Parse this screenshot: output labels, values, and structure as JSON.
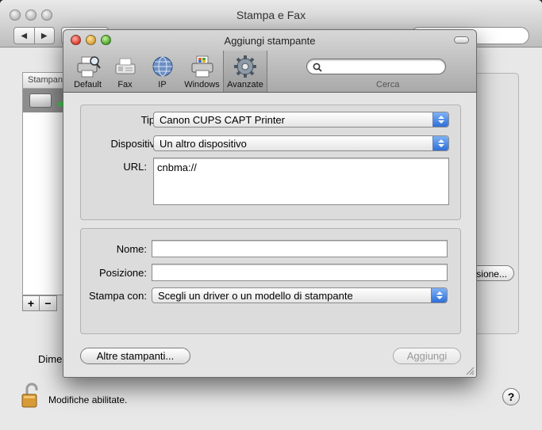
{
  "background_window": {
    "title": "Stampa e Fax",
    "printer_list_header": "Stampan",
    "options_button_partial": "sione...",
    "default_label_partial": "Dime",
    "lock_label": "Modifiche abilitate.",
    "help_glyph": "?",
    "add_glyph": "+",
    "remove_glyph": "−",
    "back_glyph": "◀",
    "forward_glyph": "▶"
  },
  "dialog": {
    "title": "Aggiungi stampante",
    "toolbar": [
      {
        "label": "Default",
        "icon": "printer-magnifier-icon"
      },
      {
        "label": "Fax",
        "icon": "fax-icon"
      },
      {
        "label": "IP",
        "icon": "globe-icon"
      },
      {
        "label": "Windows",
        "icon": "windows-printer-icon"
      },
      {
        "label": "Avanzate",
        "icon": "gear-icon",
        "selected": true
      }
    ],
    "search": {
      "placeholder": "",
      "caption": "Cerca"
    },
    "section1": {
      "tipo_label": "Tipo:",
      "tipo_value": "Canon CUPS CAPT Printer",
      "dispositivo_label": "Dispositivo:",
      "dispositivo_value": "Un altro dispositivo",
      "url_label": "URL:",
      "url_value": "cnbma://"
    },
    "section2": {
      "nome_label": "Nome:",
      "nome_value": "",
      "posizione_label": "Posizione:",
      "posizione_value": "",
      "stampa_con_label": "Stampa con:",
      "stampa_con_value": "Scegli un driver o un modello di stampante"
    },
    "buttons": {
      "more_printers": "Altre stampanti...",
      "add": "Aggiungi"
    }
  },
  "colors": {
    "popup_arrow_blue": "#2f6fd8",
    "close_red": "#d93b2c",
    "minimize_yellow": "#d4a13b",
    "zoom_green": "#4aa52b"
  }
}
